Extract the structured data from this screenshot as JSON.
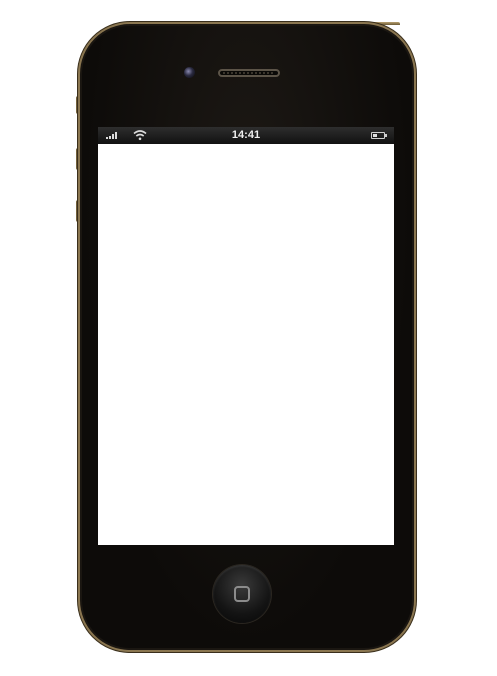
{
  "status_bar": {
    "time": "14:41",
    "signal_bars": 4,
    "battery_level": 0.35
  },
  "icons": {
    "signal": "signal-bars-icon",
    "wifi": "wifi-icon",
    "battery": "battery-icon",
    "home": "home-button-icon",
    "camera": "front-camera-icon",
    "speaker": "earpiece-speaker-icon"
  },
  "colors": {
    "bezel": "#0d0b09",
    "frame": "#8a7650",
    "screen": "#ffffff",
    "status_bar": "#111111"
  }
}
